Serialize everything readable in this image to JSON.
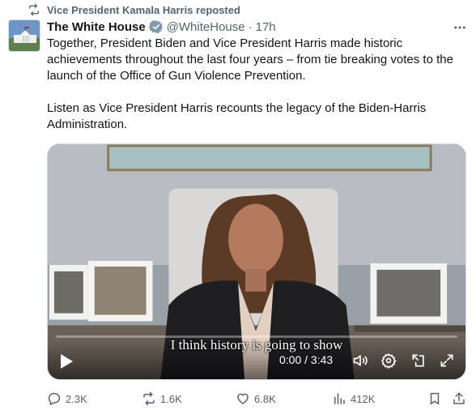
{
  "repost": {
    "icon": "repost-icon",
    "label": "Vice President Kamala Harris reposted"
  },
  "tweet": {
    "author_name": "The White House",
    "verified_icon": "verified-badge-icon",
    "handle": "@WhiteHouse",
    "separator": "·",
    "time": "17h",
    "more_icon": "more-icon",
    "paragraphs": [
      "Together, President Biden and Vice President Harris made historic achievements throughout the last four years – from tie breaking votes to the launch of the Office of Gun Violence Prevention.",
      "Listen as Vice President Harris recounts the legacy of the Biden-Harris Administration."
    ]
  },
  "video": {
    "subtitle": "I think history is going to show",
    "timecode": "0:00 / 3:43",
    "progress_fraction": 0,
    "controls": [
      "play-icon",
      "volume-icon",
      "settings-icon",
      "pip-icon",
      "fullscreen-icon"
    ]
  },
  "actions": {
    "replies": "2.3K",
    "reposts": "1.6K",
    "likes": "6.8K",
    "views": "412K"
  },
  "colors": {
    "text": "#0f1419",
    "muted": "#536471",
    "verified": "#829aab"
  }
}
